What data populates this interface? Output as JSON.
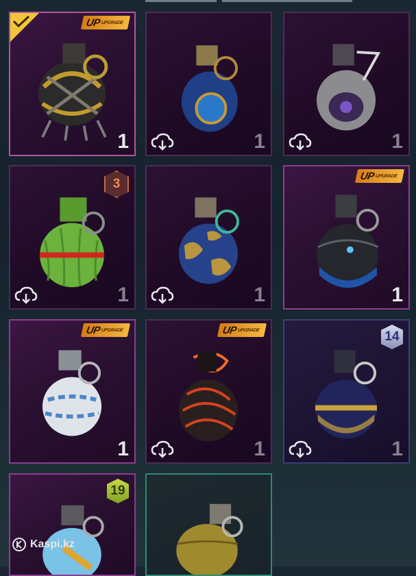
{
  "items": [
    {
      "name": "Chained Gold Grenade",
      "count": "1",
      "badge": "UP",
      "selected": true,
      "cloud": false,
      "count_dim": false
    },
    {
      "name": "Blue Orb Grenade",
      "count": "1",
      "badge": null,
      "selected": false,
      "cloud": true,
      "count_dim": true
    },
    {
      "name": "Silver Eye Grenade",
      "count": "1",
      "badge": null,
      "selected": false,
      "cloud": true,
      "count_dim": true
    },
    {
      "name": "Watermelon Grenade",
      "count": "1",
      "badge": "3",
      "selected": false,
      "cloud": true,
      "count_dim": true
    },
    {
      "name": "Globe Grenade",
      "count": "1",
      "badge": null,
      "selected": false,
      "cloud": true,
      "count_dim": true
    },
    {
      "name": "Black Lace Grenade",
      "count": "1",
      "badge": "UP",
      "selected": false,
      "cloud": false,
      "count_dim": false
    },
    {
      "name": "Frosted Grenade",
      "count": "1",
      "badge": "UP",
      "selected": false,
      "cloud": false,
      "count_dim": false
    },
    {
      "name": "Lava Dragon Grenade",
      "count": "1",
      "badge": "UP",
      "selected": false,
      "cloud": true,
      "count_dim": true
    },
    {
      "name": "Navy Gold Grenade",
      "count": "1",
      "badge": "14",
      "selected": false,
      "cloud": true,
      "count_dim": true
    },
    {
      "name": "Potion Grenade",
      "count": "",
      "badge": "19",
      "selected": false,
      "cloud": false,
      "count_dim": false
    },
    {
      "name": "Classic Grenade",
      "count": "",
      "badge": null,
      "selected": false,
      "cloud": false,
      "count_dim": false
    }
  ],
  "badge_up_text": "UP",
  "badge_up_small": "UPGRADE",
  "watermark": "Kaspi.kz",
  "colors": {
    "accent": "#f2c53a",
    "tile_border": "#8a3f8e",
    "selected_border": "#2e8a74"
  },
  "icons": {
    "cloud": "cloud-download-icon",
    "check": "check-icon"
  }
}
